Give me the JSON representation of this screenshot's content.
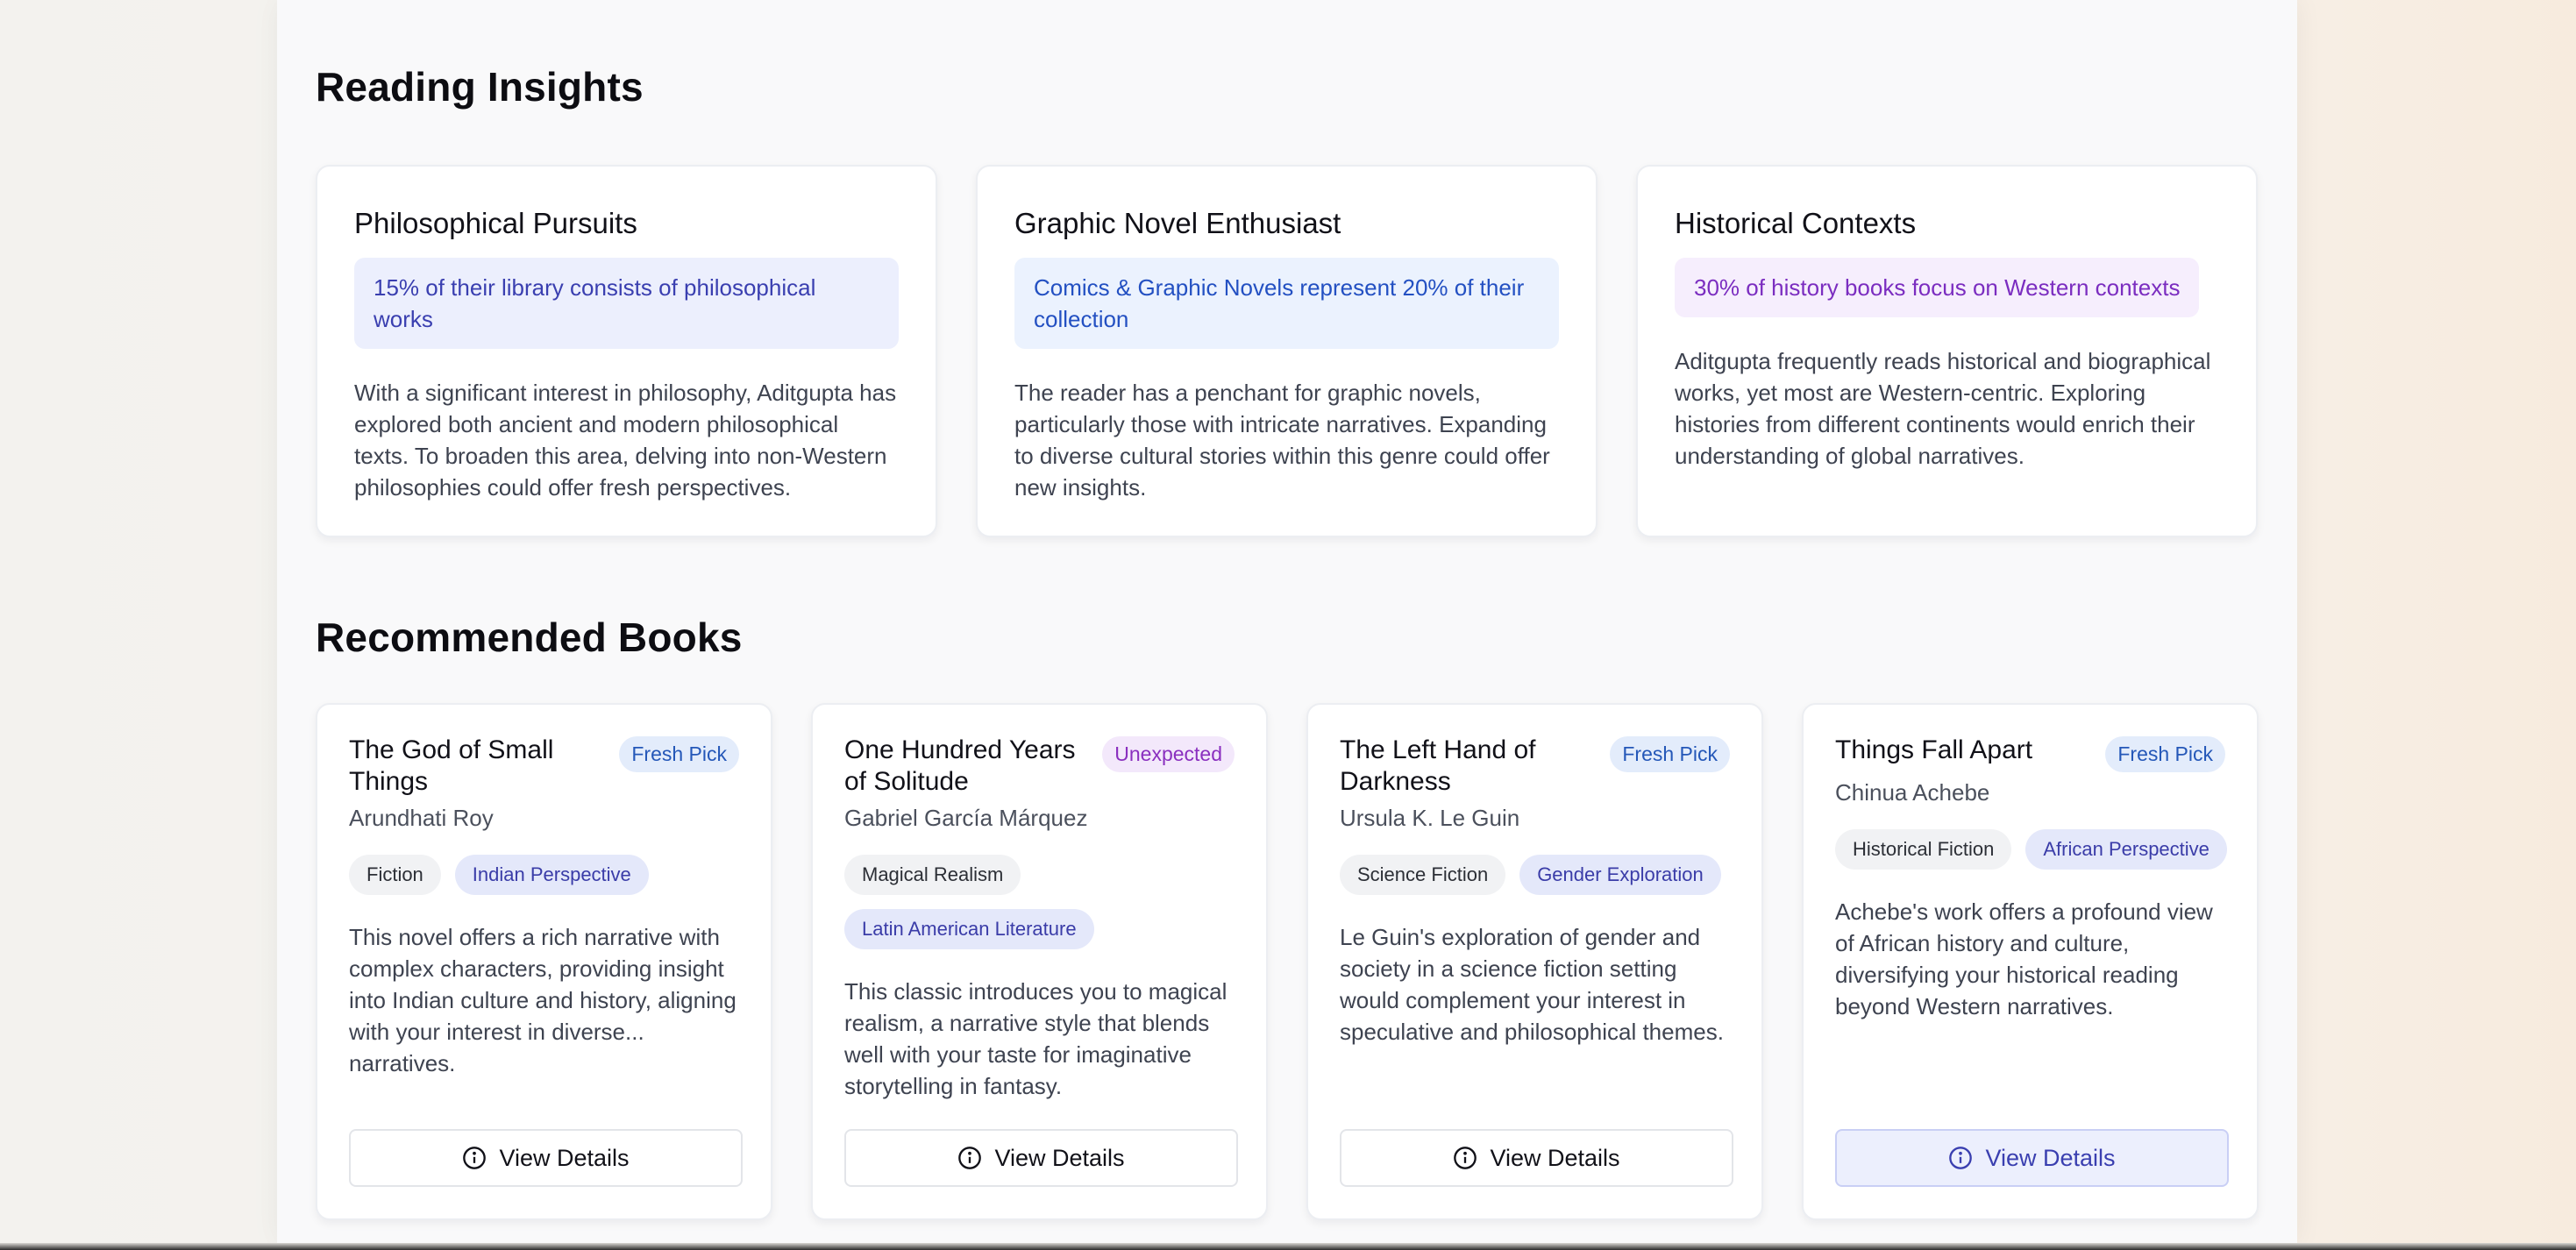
{
  "insights_section": {
    "title": "Reading Insights",
    "cards": [
      {
        "title": "Philosophical Pursuits",
        "highlight": "15% of their library consists of philosophical works",
        "text": "With a significant interest in philosophy, Aditgupta has explored both ancient and modern philosophical texts. To broaden this area, delving into non-Western philosophies could offer fresh perspectives."
      },
      {
        "title": "Graphic Novel Enthusiast",
        "highlight": "Comics & Graphic Novels represent 20% of their collection",
        "text": "The reader has a penchant for graphic novels, particularly those with intricate narratives. Expanding to diverse cultural stories within this genre could offer new insights."
      },
      {
        "title": "Historical Contexts",
        "highlight": "30% of history books focus on Western contexts",
        "text": "Aditgupta frequently reads historical and biographical works, yet most are Western-centric. Exploring histories from different continents would enrich their understanding of global narratives."
      }
    ]
  },
  "books_section": {
    "title": "Recommended Books",
    "details_label": "View Details",
    "books": [
      {
        "title": "The God of Small Things",
        "badge": "Fresh Pick",
        "author": "Arundhati Roy",
        "tags": [
          "Fiction",
          "Indian Perspective"
        ],
        "description": "This novel offers a rich narrative with complex characters, providing insight into Indian culture and history, aligning with your interest in diverse... narratives."
      },
      {
        "title": "One Hundred Years of Solitude",
        "badge": "Unexpected",
        "author": "Gabriel García Márquez",
        "tags": [
          "Magical Realism",
          "Latin American Literature"
        ],
        "description": "This classic introduces you to magical realism, a narrative style that blends well with your taste for imaginative storytelling in fantasy."
      },
      {
        "title": "The Left Hand of Darkness",
        "badge": "Fresh Pick",
        "author": "Ursula K. Le Guin",
        "tags": [
          "Science Fiction",
          "Gender Exploration"
        ],
        "description": "Le Guin's exploration of gender and society in a science fiction setting would complement your interest in speculative and philosophical themes."
      },
      {
        "title": "Things Fall Apart",
        "badge": "Fresh Pick",
        "author": "Chinua Achebe",
        "tags": [
          "Historical Fiction",
          "African Perspective"
        ],
        "description": "Achebe's work offers a profound view of African history and culture, diversifying your historical reading beyond Western narratives."
      }
    ]
  },
  "colors": {
    "accent_indigo": "#3a3fb0",
    "badge_fresh": "#2457b8",
    "badge_unexpected": "#8a2fbf"
  },
  "icons": {
    "details": "info-circle-icon"
  }
}
